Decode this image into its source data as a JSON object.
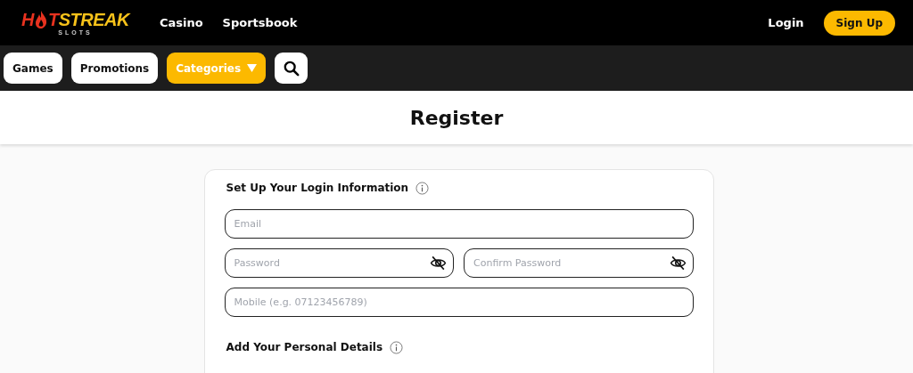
{
  "header": {
    "logo": {
      "first": "H",
      "second": "T",
      "rest": "STREAK",
      "sub": "SLOTS"
    },
    "links": [
      "Casino",
      "Sportsbook"
    ],
    "login": "Login",
    "signup": "Sign Up"
  },
  "nav": [
    {
      "kind": "button",
      "label": "Games"
    },
    {
      "kind": "button",
      "label": "Promotions"
    },
    {
      "kind": "dropdown",
      "label": "Categories"
    },
    {
      "kind": "search"
    }
  ],
  "page_title": "Register",
  "sections": [
    {
      "title": "Set Up Your Login Information",
      "rows": [
        [
          {
            "kind": "text",
            "placeholder": "Email"
          }
        ],
        [
          {
            "kind": "password",
            "placeholder": "Password"
          },
          {
            "kind": "password",
            "placeholder": "Confirm Password"
          }
        ],
        [
          {
            "kind": "text",
            "placeholder": "Mobile (e.g. 07123456789)"
          }
        ]
      ]
    },
    {
      "title": "Add Your Personal Details"
    }
  ]
}
